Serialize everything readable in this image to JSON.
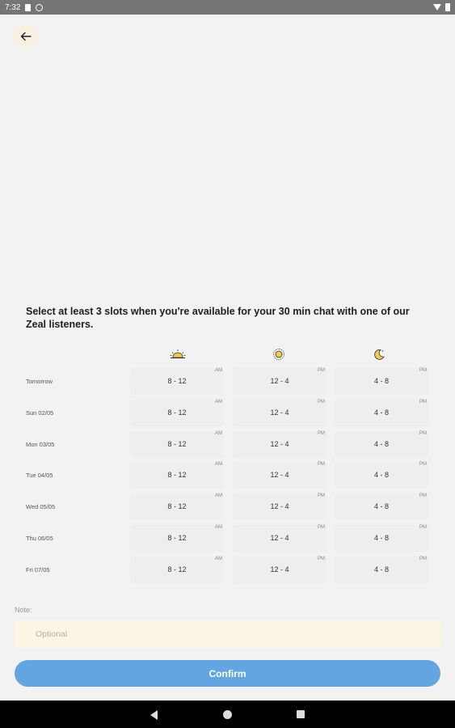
{
  "status_bar": {
    "time": "7:32"
  },
  "instruction": "Select at least 3 slots when you're available for your 30 min chat with one of our Zeal listeners.",
  "time_icons": [
    "sunrise-icon",
    "sun-icon",
    "moon-icon"
  ],
  "slots": [
    {
      "range": "8 - 12",
      "suffix": "AM"
    },
    {
      "range": "12 - 4",
      "suffix": "PM"
    },
    {
      "range": "4 - 8",
      "suffix": "PM"
    }
  ],
  "days": [
    "Tomorrow",
    "Sun 02/05",
    "Mon 03/05",
    "Tue 04/05",
    "Wed 05/05",
    "Thu 06/05",
    "Fri 07/05"
  ],
  "note": {
    "label": "Note:",
    "placeholder": "Optional",
    "value": ""
  },
  "confirm_label": "Confirm",
  "colors": {
    "accent": "#62a5e0",
    "note_bg": "#fbf5e6",
    "icon_yellow": "#f2c94c"
  }
}
